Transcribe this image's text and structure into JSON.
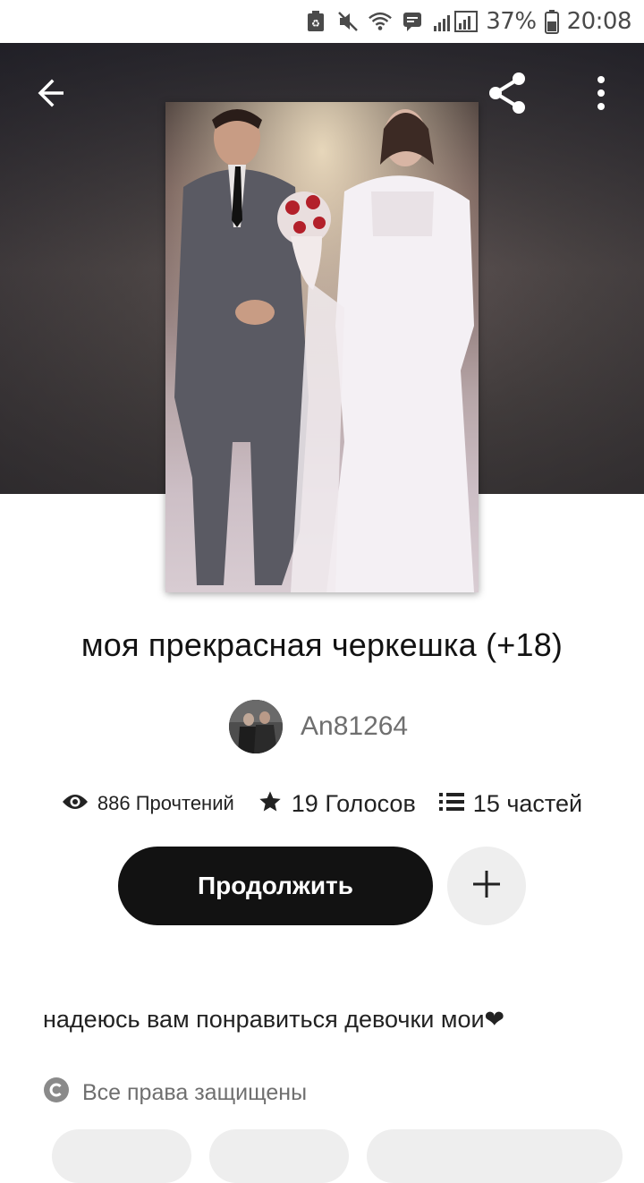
{
  "status_bar": {
    "battery_percent": "37%",
    "time": "20:08",
    "icons": [
      "recycle-notification-icon",
      "mute-icon",
      "wifi-icon",
      "message-icon",
      "signal-icon",
      "battery-icon"
    ]
  },
  "header": {
    "back_icon": "arrow-left-icon",
    "share_icon": "share-icon",
    "more_icon": "more-vertical-icon"
  },
  "story": {
    "title": "моя прекрасная черкешка (+18)",
    "author": "An81264",
    "reads": "886 Прочтений",
    "votes": "19 Голосов",
    "parts": "15 частей",
    "continue_label": "Продолжить",
    "add_icon": "plus-icon",
    "description": "надеюсь вам понравиться девочки мои❤",
    "copyright": "Все права защищены"
  },
  "colors": {
    "primary_button": "#121212",
    "secondary_button": "#eeeeee",
    "muted_text": "#6f6f6f"
  }
}
